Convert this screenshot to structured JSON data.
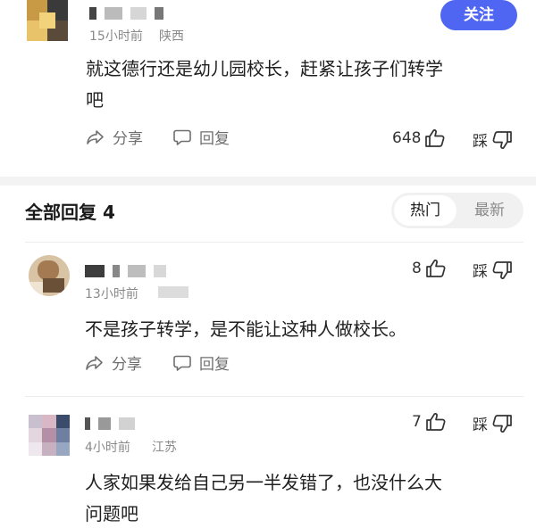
{
  "top_comment": {
    "time": "15小时前",
    "location": "陕西",
    "follow_label": "关注",
    "text_line1": "就这德行还是幼儿园校长，赶紧让孩子们转学",
    "text_line2": "吧",
    "share_label": "分享",
    "reply_label": "回复",
    "like_count": "648",
    "dislike_label": "踩"
  },
  "replies_header": {
    "title": "全部回复 4",
    "tab_hot": "热门",
    "tab_new": "最新"
  },
  "replies": [
    {
      "time": "13小时前",
      "text": "不是孩子转学，是不能让这种人做校长。",
      "share_label": "分享",
      "reply_label": "回复",
      "like_count": "8",
      "dislike_label": "踩"
    },
    {
      "time": "4小时前",
      "location": "江苏",
      "text_line1": "人家如果发给自己另一半发错了，也没什么大",
      "text_line2": "问题吧",
      "like_count": "7",
      "dislike_label": "踩"
    }
  ],
  "colors": {
    "accent": "#4f66f2",
    "muted": "#8a8a8a",
    "divider": "#f3f3f3"
  }
}
